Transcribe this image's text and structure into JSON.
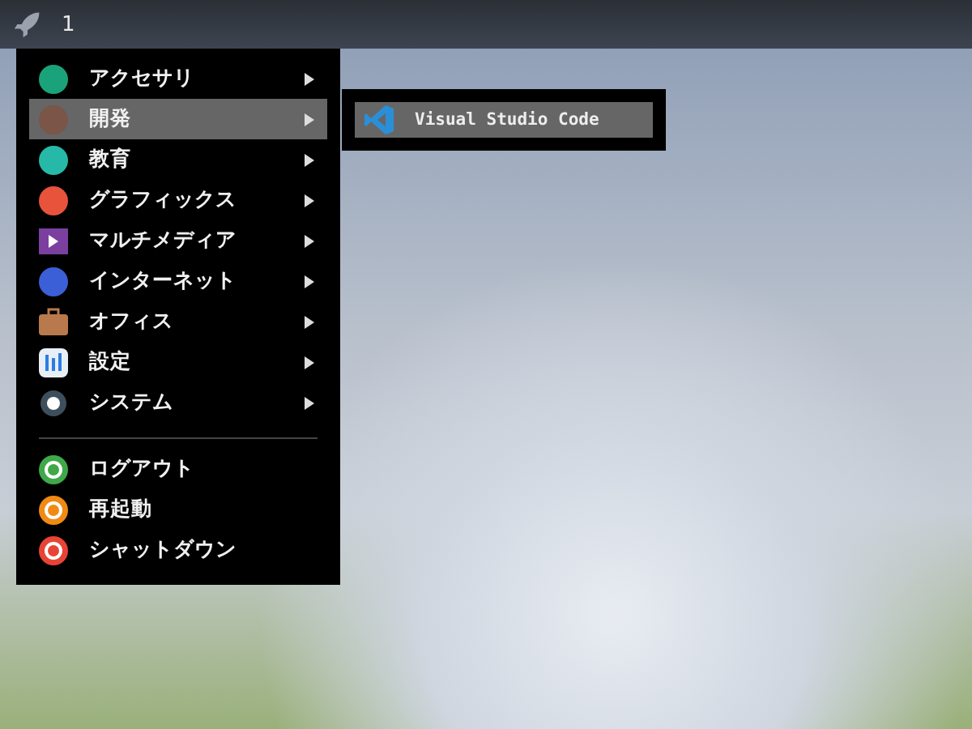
{
  "panel": {
    "workspace": "1"
  },
  "menu": {
    "groups": [
      [
        {
          "label": "アクセサリ",
          "selected": false,
          "has_submenu": true
        },
        {
          "label": "開発",
          "selected": true,
          "has_submenu": true
        },
        {
          "label": "教育",
          "selected": false,
          "has_submenu": true
        },
        {
          "label": "グラフィックス",
          "selected": false,
          "has_submenu": true
        },
        {
          "label": "マルチメディア",
          "selected": false,
          "has_submenu": true
        },
        {
          "label": "インターネット",
          "selected": false,
          "has_submenu": true
        },
        {
          "label": "オフィス",
          "selected": false,
          "has_submenu": true
        },
        {
          "label": "設定",
          "selected": false,
          "has_submenu": true
        },
        {
          "label": "システム",
          "selected": false,
          "has_submenu": true
        }
      ],
      [
        {
          "label": "ログアウト",
          "selected": false,
          "has_submenu": false
        },
        {
          "label": "再起動",
          "selected": false,
          "has_submenu": false
        },
        {
          "label": "シャットダウン",
          "selected": false,
          "has_submenu": false
        }
      ]
    ]
  },
  "submenu": {
    "items": [
      {
        "label": "Visual Studio Code",
        "selected": true
      }
    ]
  }
}
